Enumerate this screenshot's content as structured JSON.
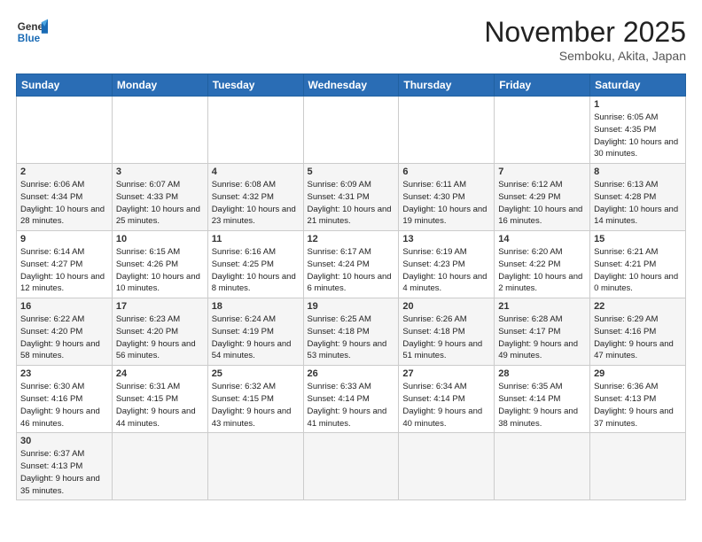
{
  "logo": {
    "line1": "General",
    "line2": "Blue"
  },
  "header": {
    "month": "November 2025",
    "location": "Semboku, Akita, Japan"
  },
  "days_of_week": [
    "Sunday",
    "Monday",
    "Tuesday",
    "Wednesday",
    "Thursday",
    "Friday",
    "Saturday"
  ],
  "weeks": [
    [
      {
        "day": "",
        "info": ""
      },
      {
        "day": "",
        "info": ""
      },
      {
        "day": "",
        "info": ""
      },
      {
        "day": "",
        "info": ""
      },
      {
        "day": "",
        "info": ""
      },
      {
        "day": "",
        "info": ""
      },
      {
        "day": "1",
        "info": "Sunrise: 6:05 AM\nSunset: 4:35 PM\nDaylight: 10 hours and 30 minutes."
      }
    ],
    [
      {
        "day": "2",
        "info": "Sunrise: 6:06 AM\nSunset: 4:34 PM\nDaylight: 10 hours and 28 minutes."
      },
      {
        "day": "3",
        "info": "Sunrise: 6:07 AM\nSunset: 4:33 PM\nDaylight: 10 hours and 25 minutes."
      },
      {
        "day": "4",
        "info": "Sunrise: 6:08 AM\nSunset: 4:32 PM\nDaylight: 10 hours and 23 minutes."
      },
      {
        "day": "5",
        "info": "Sunrise: 6:09 AM\nSunset: 4:31 PM\nDaylight: 10 hours and 21 minutes."
      },
      {
        "day": "6",
        "info": "Sunrise: 6:11 AM\nSunset: 4:30 PM\nDaylight: 10 hours and 19 minutes."
      },
      {
        "day": "7",
        "info": "Sunrise: 6:12 AM\nSunset: 4:29 PM\nDaylight: 10 hours and 16 minutes."
      },
      {
        "day": "8",
        "info": "Sunrise: 6:13 AM\nSunset: 4:28 PM\nDaylight: 10 hours and 14 minutes."
      }
    ],
    [
      {
        "day": "9",
        "info": "Sunrise: 6:14 AM\nSunset: 4:27 PM\nDaylight: 10 hours and 12 minutes."
      },
      {
        "day": "10",
        "info": "Sunrise: 6:15 AM\nSunset: 4:26 PM\nDaylight: 10 hours and 10 minutes."
      },
      {
        "day": "11",
        "info": "Sunrise: 6:16 AM\nSunset: 4:25 PM\nDaylight: 10 hours and 8 minutes."
      },
      {
        "day": "12",
        "info": "Sunrise: 6:17 AM\nSunset: 4:24 PM\nDaylight: 10 hours and 6 minutes."
      },
      {
        "day": "13",
        "info": "Sunrise: 6:19 AM\nSunset: 4:23 PM\nDaylight: 10 hours and 4 minutes."
      },
      {
        "day": "14",
        "info": "Sunrise: 6:20 AM\nSunset: 4:22 PM\nDaylight: 10 hours and 2 minutes."
      },
      {
        "day": "15",
        "info": "Sunrise: 6:21 AM\nSunset: 4:21 PM\nDaylight: 10 hours and 0 minutes."
      }
    ],
    [
      {
        "day": "16",
        "info": "Sunrise: 6:22 AM\nSunset: 4:20 PM\nDaylight: 9 hours and 58 minutes."
      },
      {
        "day": "17",
        "info": "Sunrise: 6:23 AM\nSunset: 4:20 PM\nDaylight: 9 hours and 56 minutes."
      },
      {
        "day": "18",
        "info": "Sunrise: 6:24 AM\nSunset: 4:19 PM\nDaylight: 9 hours and 54 minutes."
      },
      {
        "day": "19",
        "info": "Sunrise: 6:25 AM\nSunset: 4:18 PM\nDaylight: 9 hours and 53 minutes."
      },
      {
        "day": "20",
        "info": "Sunrise: 6:26 AM\nSunset: 4:18 PM\nDaylight: 9 hours and 51 minutes."
      },
      {
        "day": "21",
        "info": "Sunrise: 6:28 AM\nSunset: 4:17 PM\nDaylight: 9 hours and 49 minutes."
      },
      {
        "day": "22",
        "info": "Sunrise: 6:29 AM\nSunset: 4:16 PM\nDaylight: 9 hours and 47 minutes."
      }
    ],
    [
      {
        "day": "23",
        "info": "Sunrise: 6:30 AM\nSunset: 4:16 PM\nDaylight: 9 hours and 46 minutes."
      },
      {
        "day": "24",
        "info": "Sunrise: 6:31 AM\nSunset: 4:15 PM\nDaylight: 9 hours and 44 minutes."
      },
      {
        "day": "25",
        "info": "Sunrise: 6:32 AM\nSunset: 4:15 PM\nDaylight: 9 hours and 43 minutes."
      },
      {
        "day": "26",
        "info": "Sunrise: 6:33 AM\nSunset: 4:14 PM\nDaylight: 9 hours and 41 minutes."
      },
      {
        "day": "27",
        "info": "Sunrise: 6:34 AM\nSunset: 4:14 PM\nDaylight: 9 hours and 40 minutes."
      },
      {
        "day": "28",
        "info": "Sunrise: 6:35 AM\nSunset: 4:14 PM\nDaylight: 9 hours and 38 minutes."
      },
      {
        "day": "29",
        "info": "Sunrise: 6:36 AM\nSunset: 4:13 PM\nDaylight: 9 hours and 37 minutes."
      }
    ],
    [
      {
        "day": "30",
        "info": "Sunrise: 6:37 AM\nSunset: 4:13 PM\nDaylight: 9 hours and 35 minutes."
      },
      {
        "day": "",
        "info": ""
      },
      {
        "day": "",
        "info": ""
      },
      {
        "day": "",
        "info": ""
      },
      {
        "day": "",
        "info": ""
      },
      {
        "day": "",
        "info": ""
      },
      {
        "day": "",
        "info": ""
      }
    ]
  ]
}
